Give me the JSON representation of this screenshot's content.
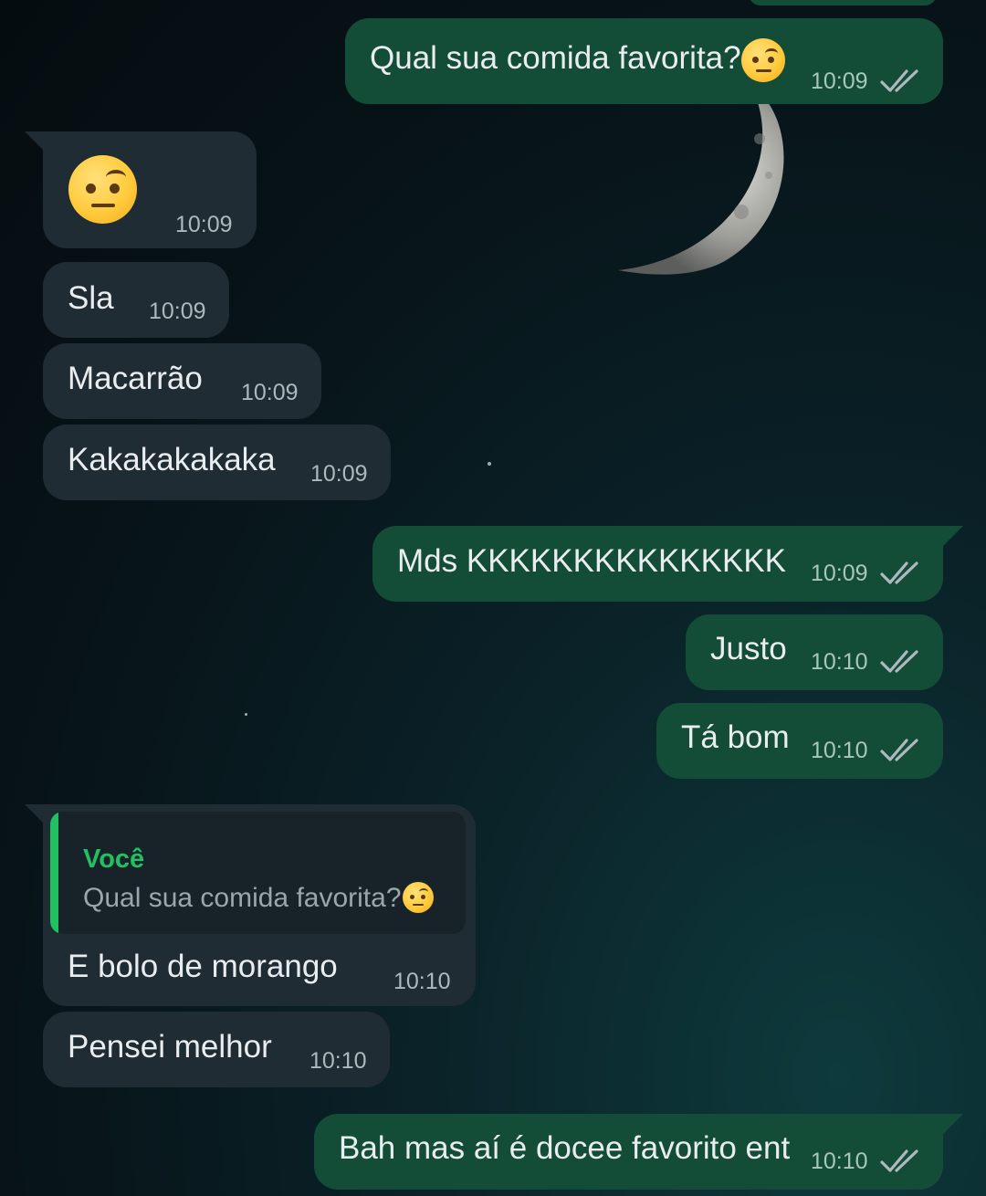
{
  "messages": [
    {
      "id": "m0",
      "direction": "out",
      "text": "Qual sua comida favorita?",
      "emoji": "face-with-raised-eyebrow",
      "time": "10:09",
      "status": "read"
    },
    {
      "id": "m1",
      "direction": "in",
      "text": "",
      "emoji": "face-with-raised-eyebrow",
      "time": "10:09"
    },
    {
      "id": "m2",
      "direction": "in",
      "text": "Sla",
      "time": "10:09"
    },
    {
      "id": "m3",
      "direction": "in",
      "text": "Macarrão",
      "time": "10:09"
    },
    {
      "id": "m4",
      "direction": "in",
      "text": "Kakakakakaka",
      "time": "10:09"
    },
    {
      "id": "m5",
      "direction": "out",
      "text": "Mds KKKKKKKKKKKKKKK",
      "time": "10:09",
      "status": "read"
    },
    {
      "id": "m6",
      "direction": "out",
      "text": "Justo",
      "time": "10:10",
      "status": "read"
    },
    {
      "id": "m7",
      "direction": "out",
      "text": "Tá bom",
      "time": "10:10",
      "status": "read"
    },
    {
      "id": "m8",
      "direction": "in",
      "text": "E bolo de morango",
      "time": "10:10",
      "reply": {
        "author": "Você",
        "text": "Qual sua comida favorita?",
        "emoji": "face-with-raised-eyebrow"
      }
    },
    {
      "id": "m9",
      "direction": "in",
      "text": "Pensei melhor",
      "time": "10:10"
    },
    {
      "id": "m10",
      "direction": "out",
      "text": "Bah mas aí é docee favorito ent",
      "time": "10:10",
      "status": "read"
    }
  ],
  "colors": {
    "outgoing_bubble": "#144d37",
    "incoming_bubble": "#1f2c34",
    "quote_accent": "#21c063",
    "read_ticks": "#aeb9be"
  },
  "icons": {
    "read_status": "double-check-icon",
    "emoji": "face-with-raised-eyebrow"
  }
}
